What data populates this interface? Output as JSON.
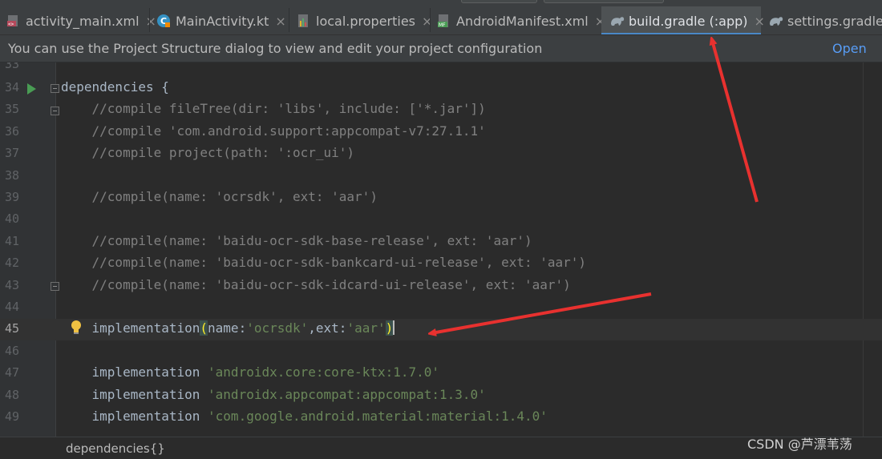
{
  "tabs": [
    {
      "label": "activity_main.xml",
      "icon": "xml-layout-icon",
      "active": false
    },
    {
      "label": "MainActivity.kt",
      "icon": "kotlin-class-icon",
      "active": false
    },
    {
      "label": "local.properties",
      "icon": "properties-file-icon",
      "active": false
    },
    {
      "label": "AndroidManifest.xml",
      "icon": "manifest-icon",
      "active": false
    },
    {
      "label": "build.gradle (:app)",
      "icon": "gradle-icon",
      "active": true
    },
    {
      "label": "settings.gradle (",
      "icon": "gradle-icon",
      "active": false
    }
  ],
  "close_glyph": "×",
  "notification": {
    "message": "You can use the Project Structure dialog to view and edit your project configuration",
    "action": "Open (Ct"
  },
  "editor": {
    "top_line_number": "33",
    "lines": [
      {
        "n": "34",
        "code": "dependencies {"
      },
      {
        "n": "35",
        "code": "    //compile fileTree(dir: 'libs', include: ['*.jar'])"
      },
      {
        "n": "36",
        "code": "    //compile 'com.android.support:appcompat-v7:27.1.1'"
      },
      {
        "n": "37",
        "code": "    //compile project(path: ':ocr_ui')"
      },
      {
        "n": "38",
        "code": ""
      },
      {
        "n": "39",
        "code": "    //compile(name: 'ocrsdk', ext: 'aar')"
      },
      {
        "n": "40",
        "code": ""
      },
      {
        "n": "41",
        "code": "    //compile(name: 'baidu-ocr-sdk-base-release', ext: 'aar')"
      },
      {
        "n": "42",
        "code": "    //compile(name: 'baidu-ocr-sdk-bankcard-ui-release', ext: 'aar')"
      },
      {
        "n": "43",
        "code": "    //compile(name: 'baidu-ocr-sdk-idcard-ui-release', ext: 'aar')"
      },
      {
        "n": "44",
        "code": ""
      },
      {
        "n": "45",
        "code": "    implementation(name:'ocrsdk',ext:'aar')"
      },
      {
        "n": "46",
        "code": ""
      },
      {
        "n": "47",
        "code": "    implementation 'androidx.core:core-ktx:1.7.0'"
      },
      {
        "n": "48",
        "code": "    implementation 'androidx.appcompat:appcompat:1.3.0'"
      },
      {
        "n": "49",
        "code": "    implementation 'com.google.android.material:material:1.4.0'"
      }
    ],
    "current_line": "45"
  },
  "breadcrumb": "dependencies{}",
  "watermark": "CSDN @芦漂苇荡",
  "colors": {
    "accent": "#4a88c7",
    "annotation_arrow": "#e8312f",
    "string": "#6a8759",
    "comment": "#808080"
  }
}
